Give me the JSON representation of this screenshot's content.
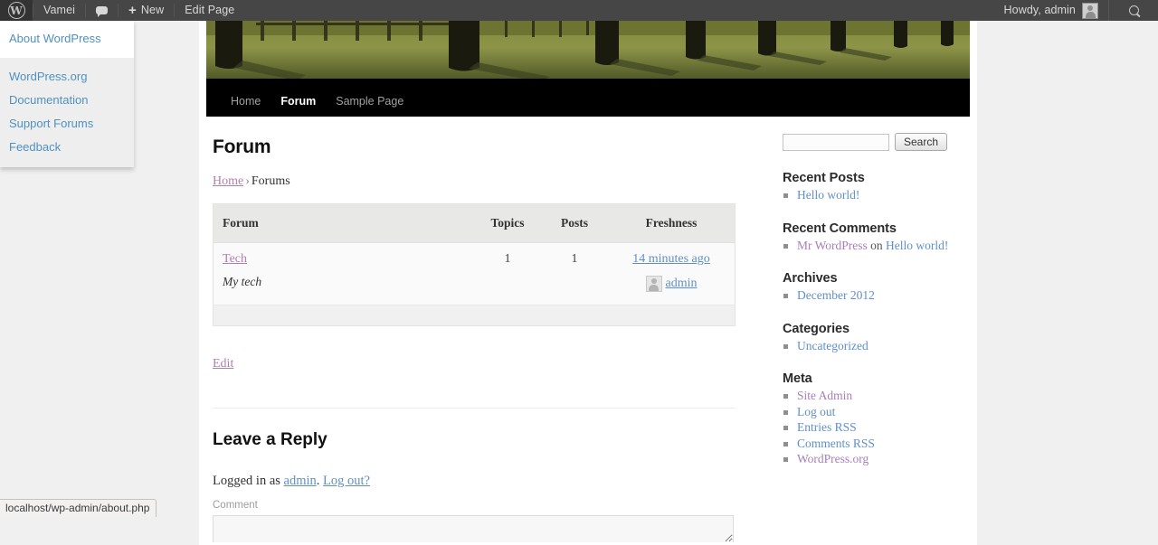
{
  "adminbar": {
    "logo_icon": "wordpress-logo-icon",
    "site_name": "Vamei",
    "comments_icon": "comment-bubble-icon",
    "new_label": "New",
    "edit_page_label": "Edit Page",
    "howdy": "Howdy, admin",
    "avatar_icon": "user-avatar-icon",
    "search_icon": "search-icon",
    "dropdown": {
      "primary": [
        {
          "label": "About WordPress"
        }
      ],
      "secondary": [
        {
          "label": "WordPress.org"
        },
        {
          "label": "Documentation"
        },
        {
          "label": "Support Forums"
        },
        {
          "label": "Feedback"
        }
      ]
    }
  },
  "site": {
    "header_image_alt": "tree-trunks-and-fence-header-image",
    "nav": [
      {
        "label": "Home",
        "current": false
      },
      {
        "label": "Forum",
        "current": true
      },
      {
        "label": "Sample Page",
        "current": false
      }
    ]
  },
  "main": {
    "page_title": "Forum",
    "breadcrumb": {
      "home": "Home",
      "separator": "›",
      "current": "Forums"
    },
    "forum_table": {
      "headers": {
        "forum": "Forum",
        "topics": "Topics",
        "posts": "Posts",
        "freshness": "Freshness"
      },
      "rows": [
        {
          "name": "Tech",
          "description": "My tech",
          "topics": "1",
          "posts": "1",
          "freshness": "14 minutes ago",
          "author": "admin",
          "author_avatar_icon": "user-avatar-icon"
        }
      ]
    },
    "edit_label": "Edit",
    "reply": {
      "title": "Leave a Reply",
      "logged_in_prefix": "Logged in as",
      "user": "admin",
      "logged_in_suffix": ".",
      "logout_label": "Log out?",
      "comment_label": "Comment",
      "comment_value": "",
      "comment_placeholder": ""
    }
  },
  "sidebar": {
    "search": {
      "value": "",
      "placeholder": "",
      "button_label": "Search"
    },
    "widgets": [
      {
        "title": "Recent Posts",
        "items": [
          {
            "text": "Hello world!",
            "style": "link"
          }
        ]
      },
      {
        "title": "Recent Comments",
        "items": [
          {
            "text": "Mr WordPress",
            "style": "visited",
            "mid": "on",
            "text2": "Hello world!"
          }
        ]
      },
      {
        "title": "Archives",
        "items": [
          {
            "text": "December 2012",
            "style": "link"
          }
        ]
      },
      {
        "title": "Categories",
        "items": [
          {
            "text": "Uncategorized",
            "style": "link"
          }
        ]
      },
      {
        "title": "Meta",
        "items": [
          {
            "text": "Site Admin",
            "style": "visited"
          },
          {
            "text": "Log out",
            "style": "link"
          },
          {
            "text": "Entries RSS",
            "style": "link"
          },
          {
            "text": "Comments RSS",
            "style": "link"
          },
          {
            "text": "WordPress.org",
            "style": "visited"
          }
        ]
      }
    ]
  },
  "statusbar": {
    "url": "localhost/wp-admin/about.php"
  }
}
